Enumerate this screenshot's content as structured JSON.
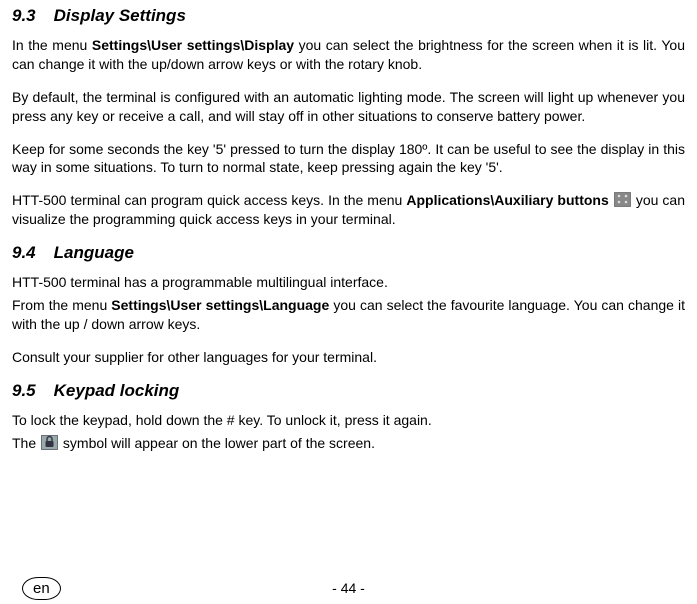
{
  "sections": {
    "s93": {
      "num": "9.3",
      "title": "Display Settings",
      "p1_before": "In the menu ",
      "p1_bold": "Settings\\User settings\\Display",
      "p1_after": " you can select the brightness for the screen when it is lit. You can change it with the up/down arrow keys or with the rotary knob.",
      "p2": "By default, the terminal is configured with an automatic lighting mode. The screen will light up whenever you press any key or receive a call, and will stay off in other situations to conserve battery power.",
      "p3": "Keep for some seconds the key '5' pressed to turn the display 180º. It can be useful to see the display in this way in some situations. To turn to normal state, keep pressing again the key '5'.",
      "p4_before": "HTT-500 terminal can program quick access keys. In the menu ",
      "p4_bold": "Applications\\Auxiliary buttons",
      "p4_after": " you can visualize the programming quick access keys in your terminal."
    },
    "s94": {
      "num": "9.4",
      "title": "Language",
      "p1": "HTT-500 terminal has a programmable multilingual interface.",
      "p2_before": "From the menu ",
      "p2_bold": "Settings\\User settings\\Language",
      "p2_after": " you can select the favourite language. You can change it with the up / down arrow keys.",
      "p3": "Consult your supplier for other languages for your terminal."
    },
    "s95": {
      "num": "9.5",
      "title": "Keypad locking",
      "p1": "To lock the keypad, hold down the # key. To unlock it, press it again.",
      "p2_before": "The ",
      "p2_after": " symbol will appear on the lower part of the screen."
    }
  },
  "footer": {
    "page": "- 44 -",
    "lang": "en"
  }
}
